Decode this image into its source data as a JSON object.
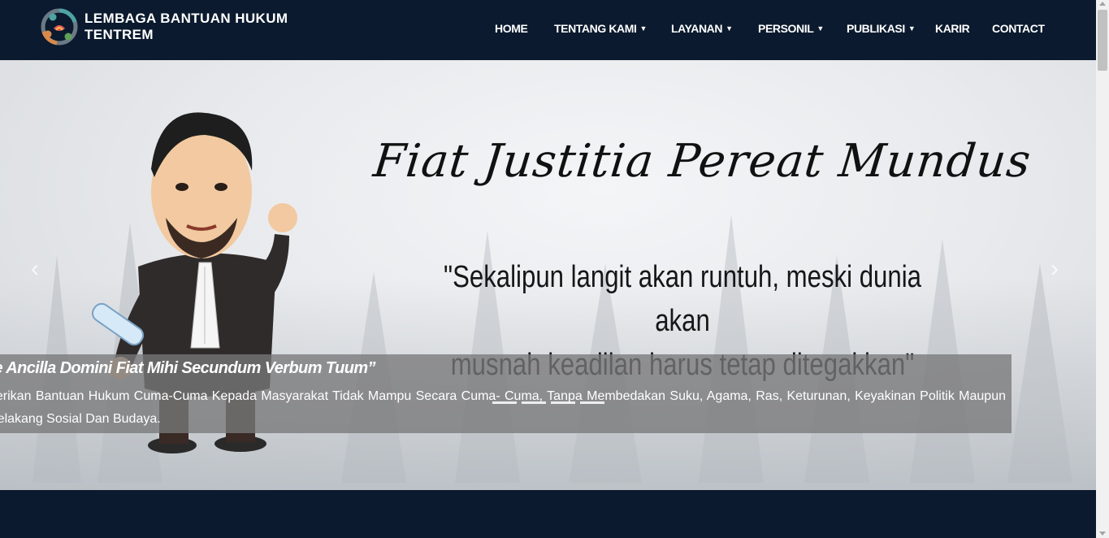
{
  "brand": {
    "line1": "LEMBAGA BANTUAN HUKUM",
    "line2": "TENTREM"
  },
  "nav": {
    "home": "HOME",
    "tentang": "TENTANG KAMI",
    "layanan": "LAYANAN",
    "personil": "PERSONIL",
    "publikasi": "PUBLIKASI",
    "karir": "KARIR",
    "contact": "CONTACT",
    "caret": "⌄"
  },
  "hero": {
    "motto": "Fiat Justitia Pereat Mundus",
    "quote_line1": "\"Sekalipun langit akan runtuh, meski dunia akan",
    "quote_line2": "musnah keadilan harus tetap ditegakkan\"",
    "prev": "‹",
    "next": "›"
  },
  "caption": {
    "title": "ce Ancilla Domini Fiat Mihi Secundum Verbum Tuum”",
    "text": "berikan Bantuan Hukum Cuma-Cuma Kepada Masyarakat Tidak Mampu Secara Cuma- Cuma, Tanpa Membedakan Suku, Agama, Ras, Keturunan, Keyakinan Politik Maupun Belakang Sosial Dan Budaya."
  },
  "colors": {
    "navy": "#0b1a2e",
    "caption_bg": "#78787a",
    "text_white": "#ffffff"
  }
}
